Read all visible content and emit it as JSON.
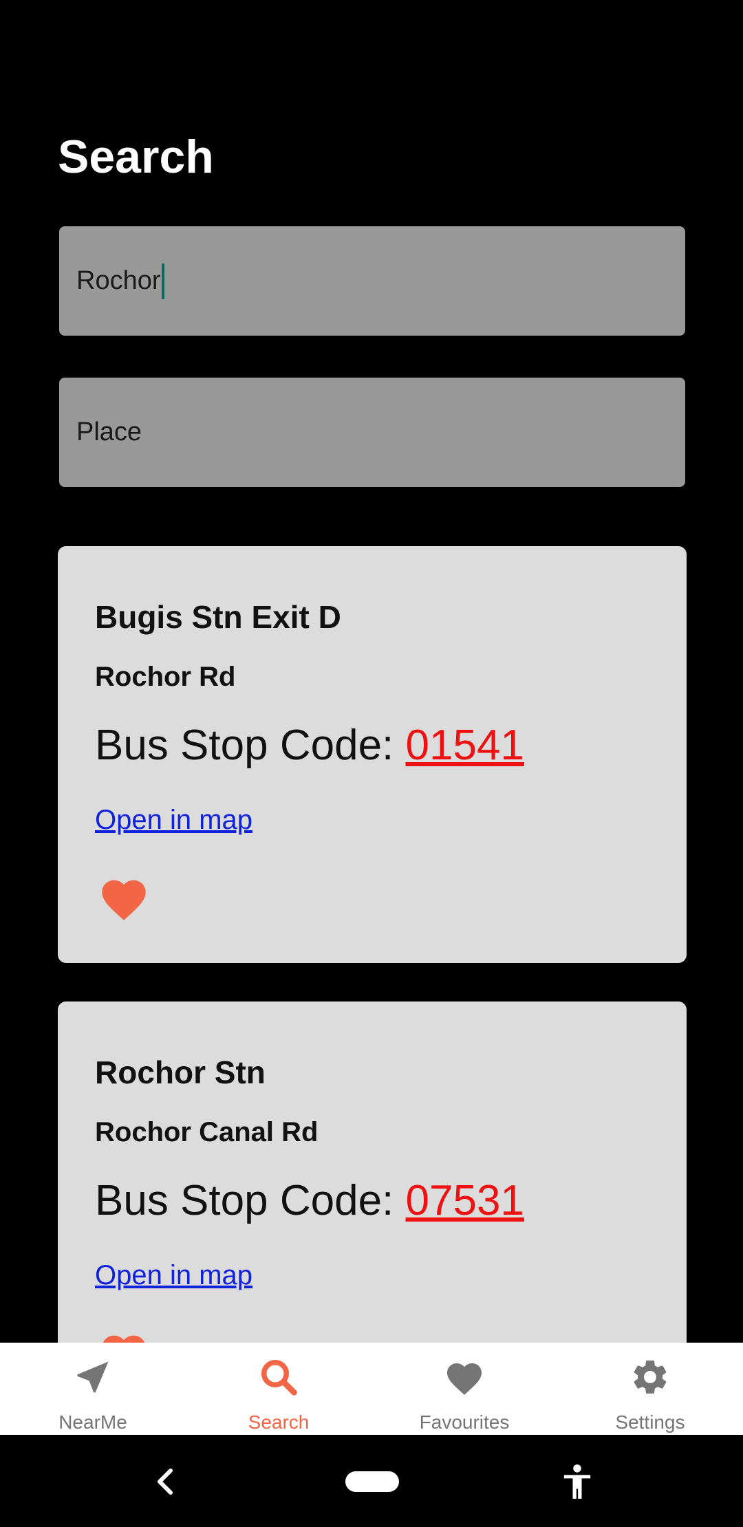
{
  "page": {
    "title": "Search"
  },
  "search": {
    "query_value": "Rochor",
    "place_placeholder": "Place"
  },
  "results": [
    {
      "name": "Bugis Stn Exit D",
      "road": "Rochor Rd",
      "code_label": "Bus Stop Code: ",
      "code": "01541",
      "map_link": "Open in map",
      "favourite_icon": "heart-icon"
    },
    {
      "name": "Rochor Stn",
      "road": "Rochor Canal Rd",
      "code_label": "Bus Stop Code: ",
      "code": "07531",
      "map_link": "Open in map",
      "favourite_icon": "heart-icon"
    }
  ],
  "bottom_nav": {
    "active": "Search",
    "items": [
      {
        "label": "NearMe",
        "icon": "navigation-arrow-icon"
      },
      {
        "label": "Search",
        "icon": "search-icon"
      },
      {
        "label": "Favourites",
        "icon": "heart-icon"
      },
      {
        "label": "Settings",
        "icon": "gear-icon"
      }
    ]
  },
  "system_nav": {
    "icons": [
      "back-icon",
      "home-pill-icon",
      "accessibility-icon"
    ]
  },
  "colors": {
    "background": "#000000",
    "field": "#999999",
    "card": "#dcdcdc",
    "accent": "#f26545",
    "code_link": "#ee1111",
    "map_link": "#1122dd",
    "nav_inactive": "#757575"
  }
}
